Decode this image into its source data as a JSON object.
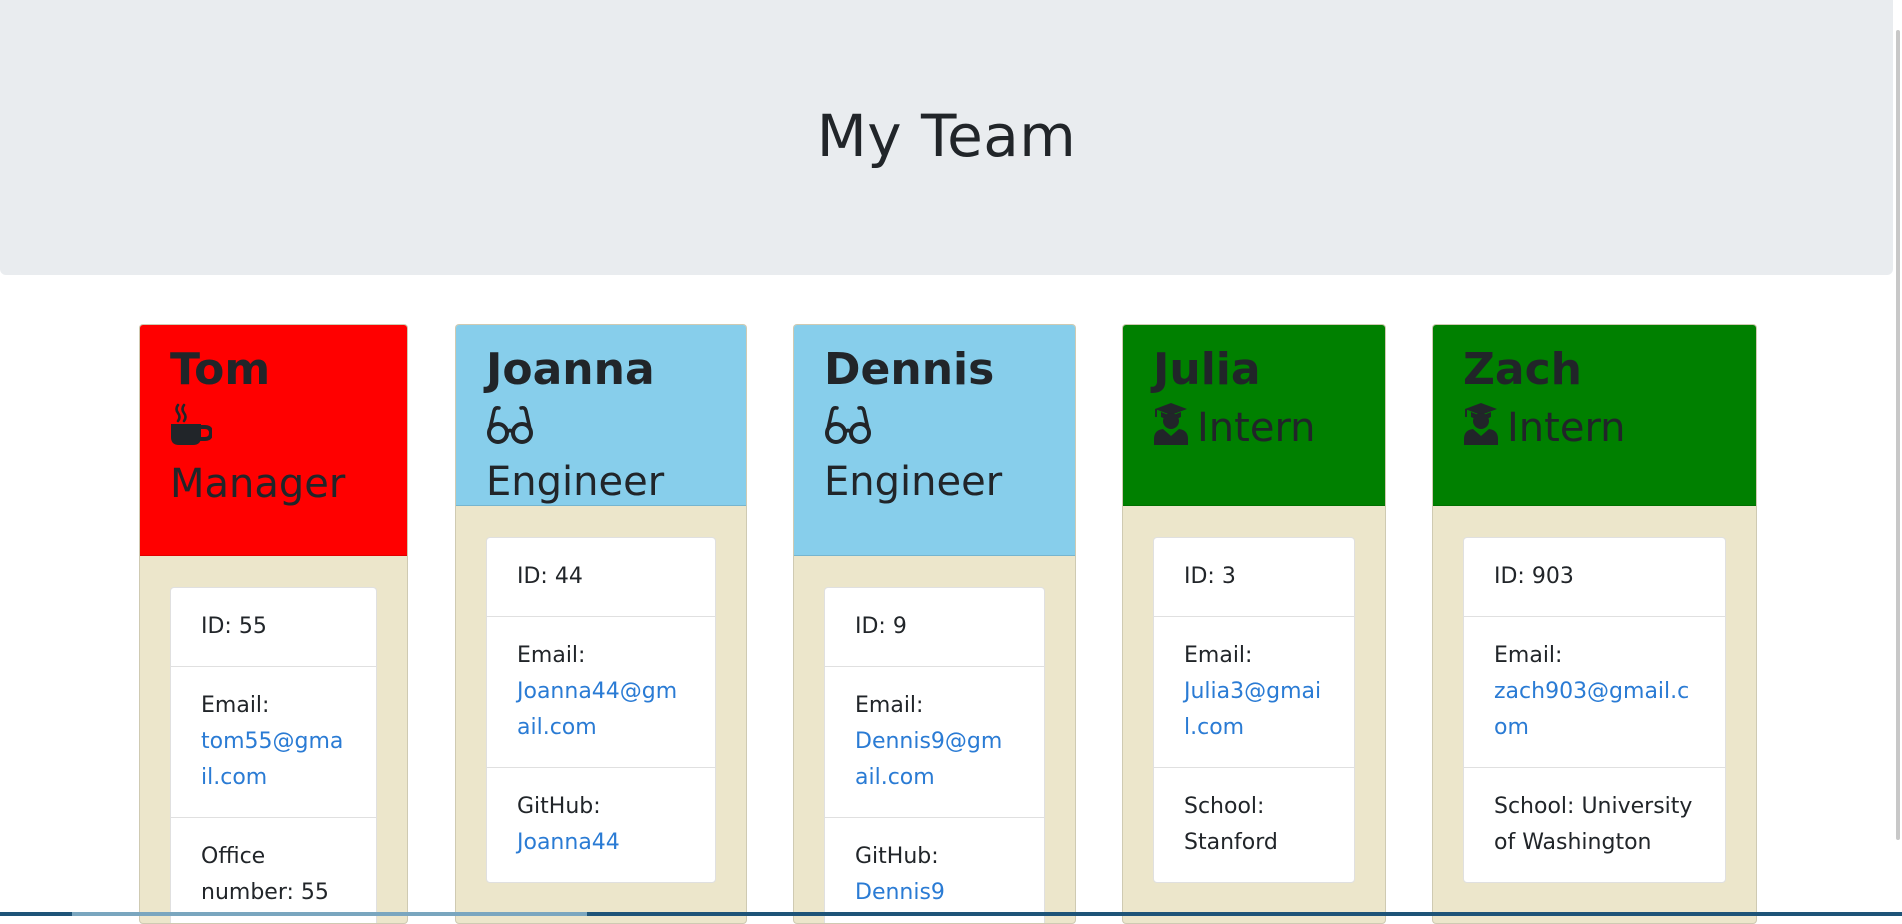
{
  "header": {
    "title": "My Team"
  },
  "team": [
    {
      "name": "Tom",
      "role": "Manager",
      "icon": "coffee-icon",
      "header_color": "#ff0000",
      "id_text": "ID: 55",
      "email_label": "Email:",
      "email": "tom55@gmail.com",
      "extra_label": "Office number: 55",
      "extra_value": null
    },
    {
      "name": "Joanna",
      "role": "Engineer",
      "icon": "glasses-icon",
      "header_color": "#87ceeb",
      "id_text": "ID: 44",
      "email_label": "Email:",
      "email": "Joanna44@gmail.com",
      "extra_label": "GitHub:",
      "extra_value": "Joanna44"
    },
    {
      "name": "Dennis",
      "role": "Engineer",
      "icon": "glasses-icon",
      "header_color": "#87ceeb",
      "id_text": "ID: 9",
      "email_label": "Email:",
      "email": "Dennis9@gmail.com",
      "extra_label": "GitHub:",
      "extra_value": "Dennis9"
    },
    {
      "name": "Julia",
      "role": "Intern",
      "icon": "graduate-icon",
      "header_color": "#008000",
      "id_text": "ID: 3",
      "email_label": "Email:",
      "email": "Julia3@gmail.com",
      "extra_label": "School: Stanford",
      "extra_value": null
    },
    {
      "name": "Zach",
      "role": "Intern",
      "icon": "graduate-icon",
      "header_color": "#008000",
      "id_text": "ID: 903",
      "email_label": "Email:",
      "email": "zach903@gmail.com",
      "extra_label": "School: University of Washington",
      "extra_value": null
    }
  ]
}
